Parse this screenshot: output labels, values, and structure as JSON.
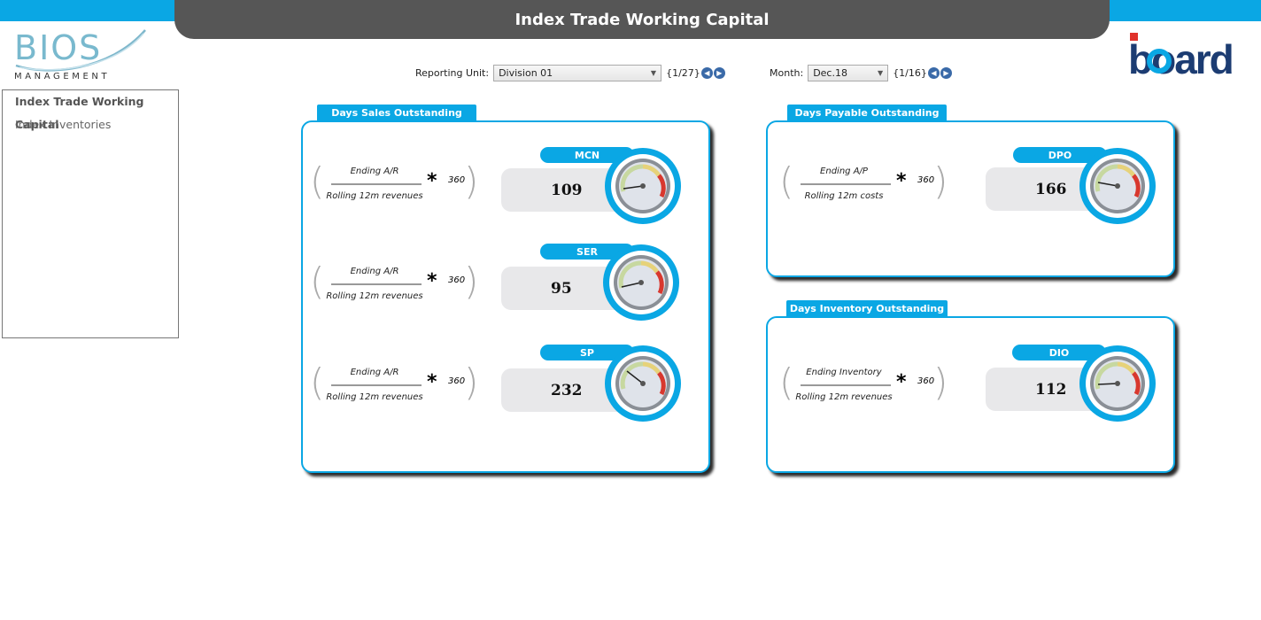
{
  "header": {
    "title": "Index Trade Working Capital"
  },
  "logos": {
    "left_main": "BIOS",
    "left_sub": "MANAGEMENT",
    "right": "board"
  },
  "colors": {
    "accent": "#0aa7e4",
    "title_bar": "#565656",
    "board_navy": "#1c3c72"
  },
  "sidebar": {
    "items": [
      {
        "label": "Index Trade Working Capital",
        "active": true
      },
      {
        "label": "Index Inventories",
        "active": false
      }
    ]
  },
  "filters": {
    "reporting_unit": {
      "label": "Reporting Unit:",
      "value": "Division 01",
      "count": "{1/27}"
    },
    "month": {
      "label": "Month:",
      "value": "Dec.18",
      "count": "{1/16}"
    }
  },
  "panels": {
    "dso": {
      "title": "Days Sales Outstanding",
      "kpis": [
        {
          "tag": "MCN",
          "value": "109",
          "numerator": "Ending A/R",
          "denominator": "Rolling 12m revenues",
          "multiplier": "360"
        },
        {
          "tag": "SER",
          "value": "95",
          "numerator": "Ending A/R",
          "denominator": "Rolling 12m revenues",
          "multiplier": "360"
        },
        {
          "tag": "SP",
          "value": "232",
          "numerator": "Ending A/R",
          "denominator": "Rolling 12m revenues",
          "multiplier": "360"
        }
      ]
    },
    "dpo": {
      "title": "Days Payable Outstanding",
      "kpis": [
        {
          "tag": "DPO",
          "value": "166",
          "numerator": "Ending A/P",
          "denominator": "Rolling 12m costs",
          "multiplier": "360"
        }
      ]
    },
    "dio": {
      "title": "Days Inventory Outstanding",
      "kpis": [
        {
          "tag": "DIO",
          "value": "112",
          "numerator": "Ending Inventory",
          "denominator": "Rolling 12m revenues",
          "multiplier": "360"
        }
      ]
    }
  },
  "icons": {
    "prev": "chevron-left-icon",
    "next": "chevron-right-icon",
    "dropdown": "chevron-down-icon",
    "gauge": "gauge-icon"
  }
}
